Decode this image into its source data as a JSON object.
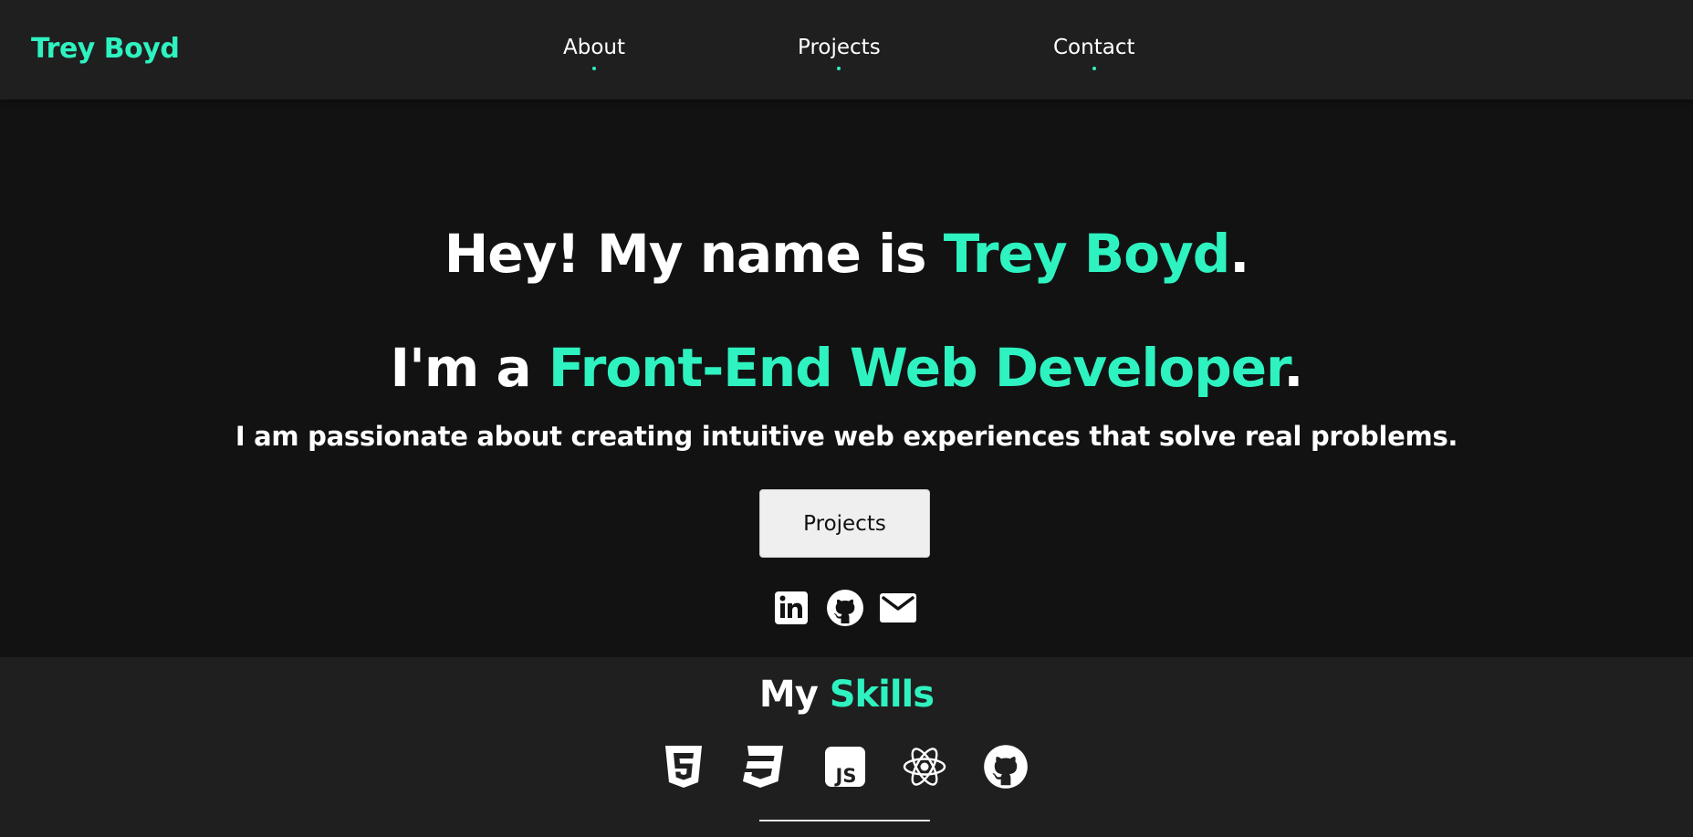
{
  "nav": {
    "brand": "Trey Boyd",
    "links": [
      "About",
      "Projects",
      "Contact"
    ]
  },
  "hero": {
    "line1_prefix": "Hey! My name is ",
    "line1_name": "Trey Boyd",
    "line1_suffix": ".",
    "line2_prefix": "I'm a ",
    "line2_role": "Front-End Web Developer",
    "line2_suffix": ".",
    "tagline": "I am passionate about creating intuitive web experiences that solve real problems.",
    "cta_label": "Projects"
  },
  "social_icons": [
    "linkedin-icon",
    "github-icon",
    "email-icon"
  ],
  "skills": {
    "title_prefix": "My ",
    "title_accent": "Skills",
    "icons": [
      "html5-icon",
      "css3-icon",
      "javascript-icon",
      "react-icon",
      "github-icon"
    ],
    "js_badge_text": "JS"
  },
  "colors": {
    "accent": "#2ef2c0",
    "page_background": "#121212",
    "panel_background": "#1f1f1f",
    "button_background": "#efefef"
  }
}
